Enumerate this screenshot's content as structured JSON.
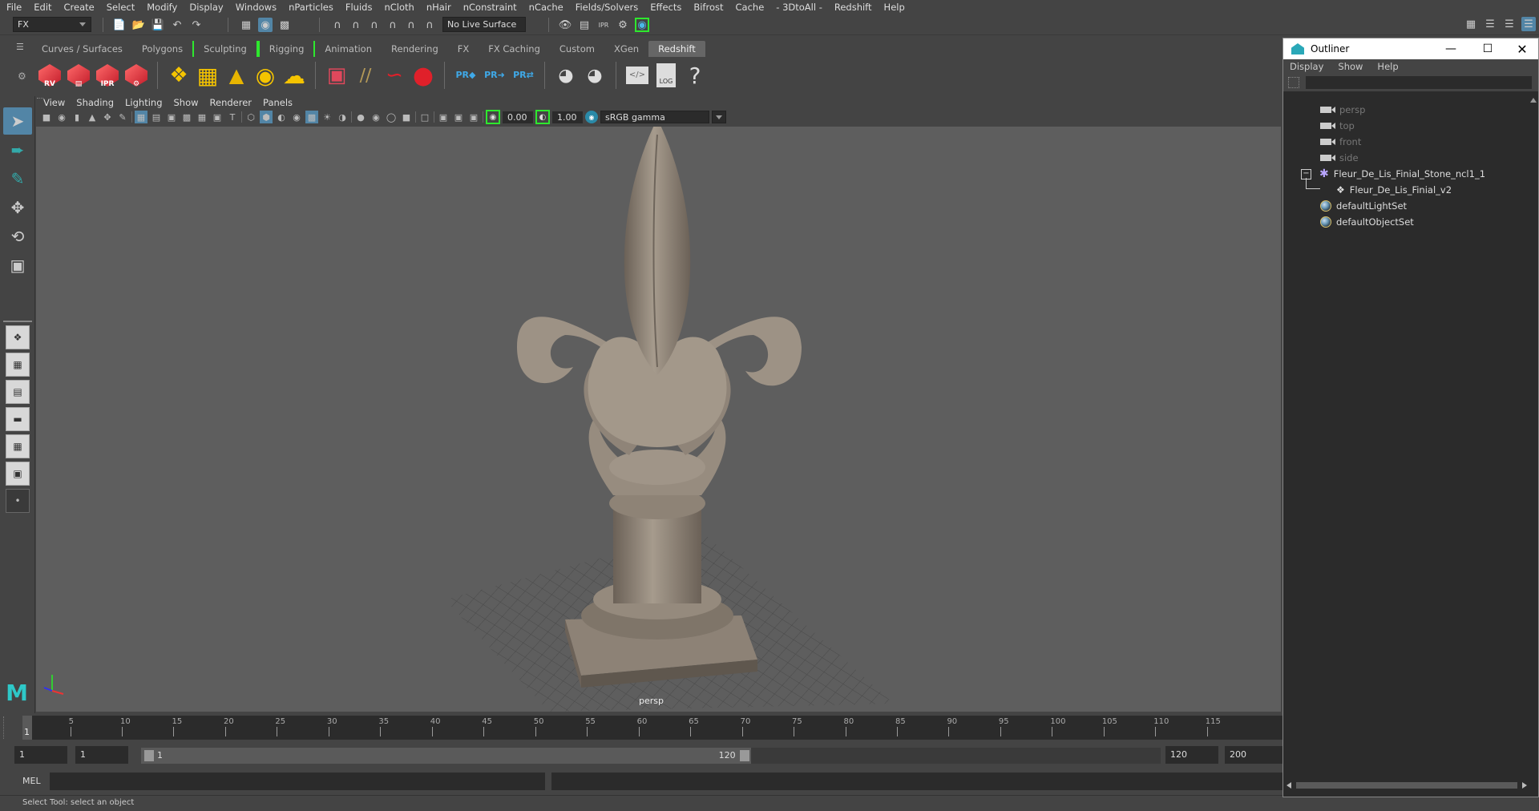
{
  "menubar": [
    "File",
    "Edit",
    "Create",
    "Select",
    "Modify",
    "Display",
    "Windows",
    "nParticles",
    "Fluids",
    "nCloth",
    "nHair",
    "nConstraint",
    "nCache",
    "Fields/Solvers",
    "Effects",
    "Bifrost",
    "Cache",
    "- 3DtoAll -",
    "Redshift",
    "Help"
  ],
  "statusline": {
    "menuset": "FX",
    "live_surface": "No Live Surface"
  },
  "shelf_tabs": [
    "Curves / Surfaces",
    "Polygons",
    "Sculpting",
    "Rigging",
    "Animation",
    "Rendering",
    "FX",
    "FX Caching",
    "Custom",
    "XGen",
    "Redshift"
  ],
  "active_shelf_tab": "Redshift",
  "shelf": {
    "render_buttons": [
      {
        "label": "RV",
        "icon": "render-view-icon"
      },
      {
        "label": "",
        "icon": "render-clapper-icon"
      },
      {
        "label": "IPR",
        "icon": "ipr-render-icon"
      },
      {
        "label": "",
        "icon": "render-settings-icon"
      }
    ],
    "pr_labels": [
      "PR",
      "PR",
      "PR"
    ],
    "log_label": "LOG",
    "help_label": "?"
  },
  "panel_menu": [
    "View",
    "Shading",
    "Lighting",
    "Show",
    "Renderer",
    "Panels"
  ],
  "panel_toolbar": {
    "exposure": "0.00",
    "gamma": "1.00",
    "color_space": "sRGB gamma"
  },
  "viewport": {
    "camera_label": "persp",
    "accent_color": "#5285a6"
  },
  "timeline": {
    "ticks": [
      5,
      10,
      15,
      20,
      25,
      30,
      35,
      40,
      45,
      50,
      55,
      60,
      65,
      70,
      75,
      80,
      85,
      90,
      95,
      100,
      105,
      110,
      115
    ],
    "current_frame": "1",
    "range_min": 1,
    "range_max": 120,
    "visible_max": 120
  },
  "range": {
    "start_frame": "1",
    "playback_start": "1",
    "slider_start": "1",
    "slider_end": "120",
    "playback_end": "120",
    "end_frame": "200"
  },
  "cmdline": {
    "label": "MEL"
  },
  "helpline": "Select Tool: select an object",
  "outliner": {
    "title": "Outliner",
    "menu": [
      "Display",
      "Show",
      "Help"
    ],
    "items": [
      {
        "label": "persp",
        "type": "camera",
        "dim": true
      },
      {
        "label": "top",
        "type": "camera",
        "dim": true
      },
      {
        "label": "front",
        "type": "camera",
        "dim": true
      },
      {
        "label": "side",
        "type": "camera",
        "dim": true
      },
      {
        "label": "Fleur_De_Lis_Finial_Stone_ncl1_1",
        "type": "group",
        "expanded": true
      },
      {
        "label": "Fleur_De_Lis_Finial_v2",
        "type": "mesh",
        "child": true
      },
      {
        "label": "defaultLightSet",
        "type": "set"
      },
      {
        "label": "defaultObjectSet",
        "type": "set"
      }
    ]
  }
}
